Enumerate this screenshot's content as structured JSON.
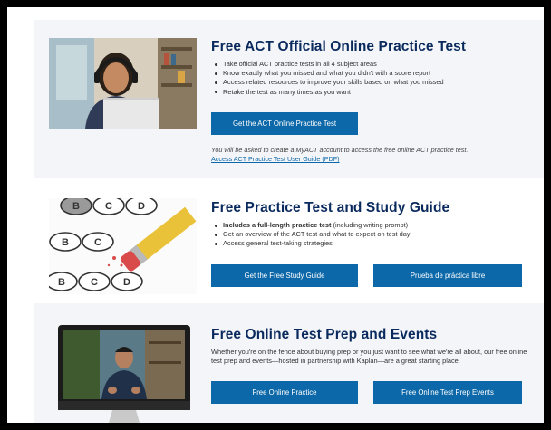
{
  "sections": [
    {
      "title": "Free ACT Official Online Practice Test",
      "bullets": [
        "Take official ACT practice tests in all 4 subject areas",
        "Know exactly what you missed and what you didn't with a score report",
        "Access related resources to improve your skills based on what you missed",
        "Retake the test as many times as you want"
      ],
      "button": "Get the ACT Online Practice Test",
      "note": "You will be asked to create a MyACT account to access the free online ACT practice test.",
      "link": "Access ACT Practice Test User Guide (PDF)"
    },
    {
      "title": "Free Practice Test and Study Guide",
      "bullet_1_bold": "Includes a full-length practice test",
      "bullet_1_rest": " (including writing prompt)",
      "bullets": [
        "Get an overview of the ACT test and what to expect on test day",
        "Access general test-taking strategies"
      ],
      "button_1": "Get the Free Study Guide",
      "button_2": "Prueba de práctica libre",
      "bubbles": [
        "B",
        "C",
        "D",
        "B",
        "C",
        "B",
        "C",
        "D"
      ]
    },
    {
      "title": "Free Online Test Prep and Events",
      "body": "Whether you're on the fence about buying prep or you just want to see what we're all about, our free online test prep and events—hosted in partnership with Kaplan—are a great starting place.",
      "button_1": "Free Online Practice",
      "button_2": "Free Online Test Prep Events"
    }
  ],
  "colors": {
    "title": "#0a2a5e",
    "button": "#0c68a8",
    "section_alt_bg": "#f4f5f9"
  }
}
